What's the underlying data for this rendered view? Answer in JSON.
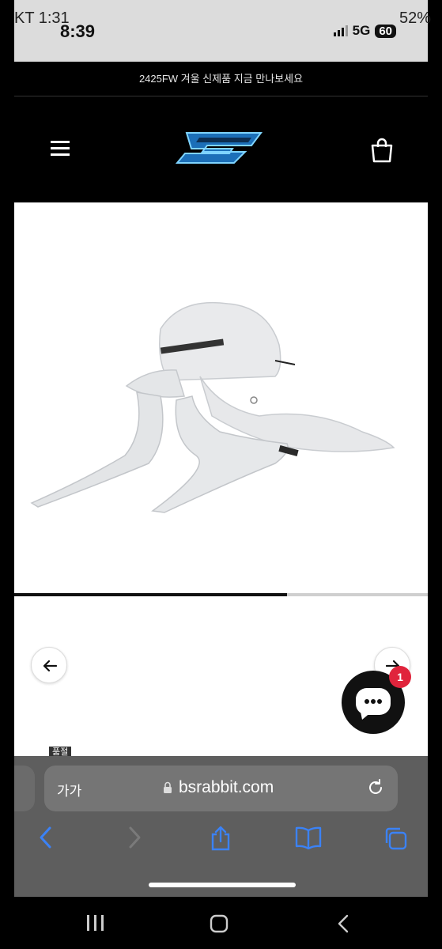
{
  "outer_status": {
    "carrier_time": "KT 1:31",
    "battery": "52%"
  },
  "inner_status": {
    "time": "8:39",
    "network": "5G",
    "battery": "60"
  },
  "announcement": "2425FW 겨울 신제품 지금 만나보세요",
  "header": {
    "menu_icon": "hamburger-icon",
    "logo": "brand-logo",
    "cart_icon": "shopping-bag-icon"
  },
  "gallery": {
    "progress": 0.66,
    "prev_icon": "arrow-left-icon",
    "next_icon": "arrow-right-icon",
    "tag": "품절"
  },
  "chat": {
    "badge_count": "1",
    "icon": "chat-icon"
  },
  "browser": {
    "text_size": "가가",
    "url": "bsrabbit.com"
  },
  "colors": {
    "accent_badge": "#e0243c",
    "safari_bar": "#5e5e5e",
    "ios_blue": "#3b82f6"
  }
}
